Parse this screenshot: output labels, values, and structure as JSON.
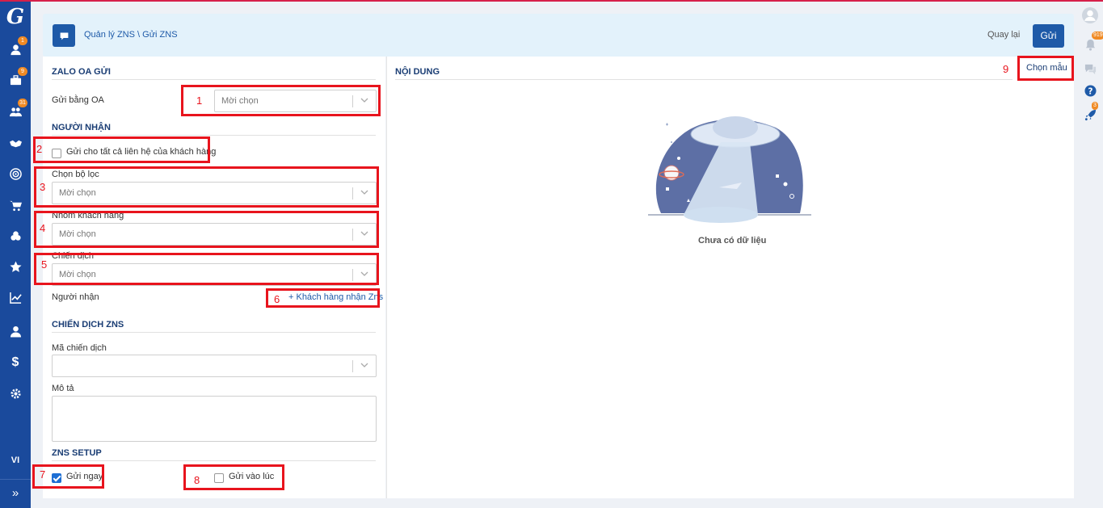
{
  "header": {
    "breadcrumb": "Quản lý ZNS \\ Gửi ZNS",
    "back_label": "Quay lại",
    "send_label": "Gửi"
  },
  "sidebar": {
    "items": [
      {
        "icon": "user-icon",
        "badge": "1"
      },
      {
        "icon": "briefcase-icon",
        "badge": "9"
      },
      {
        "icon": "users-icon",
        "badge": "31"
      },
      {
        "icon": "handshake-icon",
        "badge": ""
      },
      {
        "icon": "target-icon",
        "badge": ""
      },
      {
        "icon": "cart-icon",
        "badge": ""
      },
      {
        "icon": "boxes-icon",
        "badge": ""
      },
      {
        "icon": "star-icon",
        "badge": ""
      },
      {
        "icon": "chart-icon",
        "badge": ""
      },
      {
        "icon": "user-tie-icon",
        "badge": ""
      },
      {
        "icon": "dollar-icon",
        "badge": ""
      },
      {
        "icon": "gear-icon",
        "badge": ""
      }
    ],
    "language": "VI",
    "expand": "»"
  },
  "rail": {
    "notification_badge": "919",
    "rocket_badge": "3"
  },
  "form": {
    "zalo_section": "ZALO OA GỬI",
    "send_by_oa_label": "Gửi bằng OA",
    "send_by_oa_placeholder": "Mời chọn",
    "recipient_section": "NGƯỜI NHẬN",
    "send_all_label": "Gửi cho tất cả liên hệ của khách hàng",
    "filter_label": "Chọn bộ lọc",
    "filter_placeholder": "Mời chọn",
    "group_label": "Nhóm khách hàng",
    "group_placeholder": "Mời chọn",
    "campaign_label": "Chiến dịch",
    "campaign_placeholder": "Mời chọn",
    "recipient_label": "Người nhận",
    "add_recipient_link": "+ Khách hàng nhận Zns",
    "zns_campaign_section": "CHIẾN DỊCH ZNS",
    "campaign_code_label": "Mã chiến dịch",
    "campaign_code_value": "",
    "description_label": "Mô tả",
    "description_value": "",
    "setup_section": "ZNS SETUP",
    "send_now_label": "Gửi ngay",
    "send_now_checked": true,
    "send_at_label": "Gửi vào lúc",
    "send_at_checked": false
  },
  "content": {
    "section": "NỘI DUNG",
    "choose_template": "Chọn mẫu",
    "empty_text": "Chưa có dữ liệu"
  },
  "annotations": [
    "1",
    "2",
    "3",
    "4",
    "5",
    "6",
    "7",
    "8",
    "9"
  ]
}
